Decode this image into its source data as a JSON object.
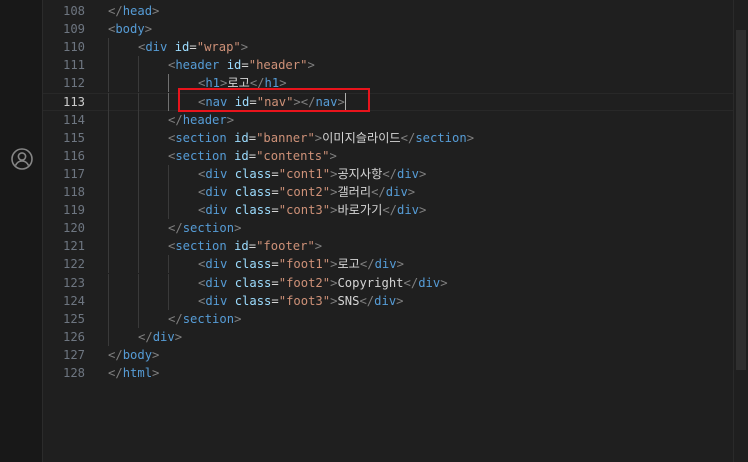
{
  "colors": {
    "background": "#1e1e1e",
    "tag": "#569cd6",
    "attribute": "#9cdcfe",
    "string": "#ce9178",
    "text": "#d4d4d4",
    "punctuation": "#808080",
    "line_number": "#6e7681",
    "highlight_box": "#e8141c"
  },
  "activity_bar": {
    "icons": [
      "account-icon"
    ]
  },
  "editor": {
    "current_line": "113",
    "lines": [
      {
        "num": "108",
        "tokens": [
          {
            "c": "t-punct",
            "v": "</"
          },
          {
            "c": "t-tag",
            "v": "head"
          },
          {
            "c": "t-punct",
            "v": ">"
          }
        ]
      },
      {
        "num": "109",
        "tokens": [
          {
            "c": "t-punct",
            "v": "<"
          },
          {
            "c": "t-tag",
            "v": "body"
          },
          {
            "c": "t-punct",
            "v": ">"
          }
        ]
      },
      {
        "num": "110",
        "tokens": [
          {
            "c": "t-punct",
            "v": "<"
          },
          {
            "c": "t-tag",
            "v": "div"
          },
          {
            "c": "t-eq",
            "v": " "
          },
          {
            "c": "t-attr",
            "v": "id"
          },
          {
            "c": "t-eq",
            "v": "="
          },
          {
            "c": "t-str",
            "v": "\"wrap\""
          },
          {
            "c": "t-punct",
            "v": ">"
          }
        ]
      },
      {
        "num": "111",
        "tokens": [
          {
            "c": "t-punct",
            "v": "<"
          },
          {
            "c": "t-tag",
            "v": "header"
          },
          {
            "c": "t-eq",
            "v": " "
          },
          {
            "c": "t-attr",
            "v": "id"
          },
          {
            "c": "t-eq",
            "v": "="
          },
          {
            "c": "t-str",
            "v": "\"header\""
          },
          {
            "c": "t-punct",
            "v": ">"
          }
        ]
      },
      {
        "num": "112",
        "tokens": [
          {
            "c": "t-punct",
            "v": "<"
          },
          {
            "c": "t-tag",
            "v": "h1"
          },
          {
            "c": "t-punct",
            "v": ">"
          },
          {
            "c": "t-text",
            "v": "로고"
          },
          {
            "c": "t-punct",
            "v": "</"
          },
          {
            "c": "t-tag",
            "v": "h1"
          },
          {
            "c": "t-punct",
            "v": ">"
          }
        ]
      },
      {
        "num": "113",
        "tokens": [
          {
            "c": "t-punct",
            "v": "<"
          },
          {
            "c": "t-tag",
            "v": "nav"
          },
          {
            "c": "t-eq",
            "v": " "
          },
          {
            "c": "t-attr",
            "v": "id"
          },
          {
            "c": "t-eq",
            "v": "="
          },
          {
            "c": "t-str",
            "v": "\"nav\""
          },
          {
            "c": "t-punct",
            "v": "></"
          },
          {
            "c": "t-tag",
            "v": "nav"
          },
          {
            "c": "t-punct",
            "v": ">"
          }
        ]
      },
      {
        "num": "114",
        "tokens": [
          {
            "c": "t-punct",
            "v": "</"
          },
          {
            "c": "t-tag",
            "v": "header"
          },
          {
            "c": "t-punct",
            "v": ">"
          }
        ]
      },
      {
        "num": "115",
        "tokens": [
          {
            "c": "t-punct",
            "v": "<"
          },
          {
            "c": "t-tag",
            "v": "section"
          },
          {
            "c": "t-eq",
            "v": " "
          },
          {
            "c": "t-attr",
            "v": "id"
          },
          {
            "c": "t-eq",
            "v": "="
          },
          {
            "c": "t-str",
            "v": "\"banner\""
          },
          {
            "c": "t-punct",
            "v": ">"
          },
          {
            "c": "t-text",
            "v": "이미지슬라이드"
          },
          {
            "c": "t-punct",
            "v": "</"
          },
          {
            "c": "t-tag",
            "v": "section"
          },
          {
            "c": "t-punct",
            "v": ">"
          }
        ]
      },
      {
        "num": "116",
        "tokens": [
          {
            "c": "t-punct",
            "v": "<"
          },
          {
            "c": "t-tag",
            "v": "section"
          },
          {
            "c": "t-eq",
            "v": " "
          },
          {
            "c": "t-attr",
            "v": "id"
          },
          {
            "c": "t-eq",
            "v": "="
          },
          {
            "c": "t-str",
            "v": "\"contents\""
          },
          {
            "c": "t-punct",
            "v": ">"
          }
        ]
      },
      {
        "num": "117",
        "tokens": [
          {
            "c": "t-punct",
            "v": "<"
          },
          {
            "c": "t-tag",
            "v": "div"
          },
          {
            "c": "t-eq",
            "v": " "
          },
          {
            "c": "t-attr",
            "v": "class"
          },
          {
            "c": "t-eq",
            "v": "="
          },
          {
            "c": "t-str",
            "v": "\"cont1\""
          },
          {
            "c": "t-punct",
            "v": ">"
          },
          {
            "c": "t-text",
            "v": "공지사항"
          },
          {
            "c": "t-punct",
            "v": "</"
          },
          {
            "c": "t-tag",
            "v": "div"
          },
          {
            "c": "t-punct",
            "v": ">"
          }
        ]
      },
      {
        "num": "118",
        "tokens": [
          {
            "c": "t-punct",
            "v": "<"
          },
          {
            "c": "t-tag",
            "v": "div"
          },
          {
            "c": "t-eq",
            "v": " "
          },
          {
            "c": "t-attr",
            "v": "class"
          },
          {
            "c": "t-eq",
            "v": "="
          },
          {
            "c": "t-str",
            "v": "\"cont2\""
          },
          {
            "c": "t-punct",
            "v": ">"
          },
          {
            "c": "t-text",
            "v": "갤러리"
          },
          {
            "c": "t-punct",
            "v": "</"
          },
          {
            "c": "t-tag",
            "v": "div"
          },
          {
            "c": "t-punct",
            "v": ">"
          }
        ]
      },
      {
        "num": "119",
        "tokens": [
          {
            "c": "t-punct",
            "v": "<"
          },
          {
            "c": "t-tag",
            "v": "div"
          },
          {
            "c": "t-eq",
            "v": " "
          },
          {
            "c": "t-attr",
            "v": "class"
          },
          {
            "c": "t-eq",
            "v": "="
          },
          {
            "c": "t-str",
            "v": "\"cont3\""
          },
          {
            "c": "t-punct",
            "v": ">"
          },
          {
            "c": "t-text",
            "v": "바로가기"
          },
          {
            "c": "t-punct",
            "v": "</"
          },
          {
            "c": "t-tag",
            "v": "div"
          },
          {
            "c": "t-punct",
            "v": ">"
          }
        ]
      },
      {
        "num": "120",
        "tokens": [
          {
            "c": "t-punct",
            "v": "</"
          },
          {
            "c": "t-tag",
            "v": "section"
          },
          {
            "c": "t-punct",
            "v": ">"
          }
        ]
      },
      {
        "num": "121",
        "tokens": [
          {
            "c": "t-punct",
            "v": "<"
          },
          {
            "c": "t-tag",
            "v": "section"
          },
          {
            "c": "t-eq",
            "v": " "
          },
          {
            "c": "t-attr",
            "v": "id"
          },
          {
            "c": "t-eq",
            "v": "="
          },
          {
            "c": "t-str",
            "v": "\"footer\""
          },
          {
            "c": "t-punct",
            "v": ">"
          }
        ]
      },
      {
        "num": "122",
        "tokens": [
          {
            "c": "t-punct",
            "v": "<"
          },
          {
            "c": "t-tag",
            "v": "div"
          },
          {
            "c": "t-eq",
            "v": " "
          },
          {
            "c": "t-attr",
            "v": "class"
          },
          {
            "c": "t-eq",
            "v": "="
          },
          {
            "c": "t-str",
            "v": "\"foot1\""
          },
          {
            "c": "t-punct",
            "v": ">"
          },
          {
            "c": "t-text",
            "v": "로고"
          },
          {
            "c": "t-punct",
            "v": "</"
          },
          {
            "c": "t-tag",
            "v": "div"
          },
          {
            "c": "t-punct",
            "v": ">"
          }
        ]
      },
      {
        "num": "123",
        "tokens": [
          {
            "c": "t-punct",
            "v": "<"
          },
          {
            "c": "t-tag",
            "v": "div"
          },
          {
            "c": "t-eq",
            "v": " "
          },
          {
            "c": "t-attr",
            "v": "class"
          },
          {
            "c": "t-eq",
            "v": "="
          },
          {
            "c": "t-str",
            "v": "\"foot2\""
          },
          {
            "c": "t-punct",
            "v": ">"
          },
          {
            "c": "t-text",
            "v": "Copyright"
          },
          {
            "c": "t-punct",
            "v": "</"
          },
          {
            "c": "t-tag",
            "v": "div"
          },
          {
            "c": "t-punct",
            "v": ">"
          }
        ]
      },
      {
        "num": "124",
        "tokens": [
          {
            "c": "t-punct",
            "v": "<"
          },
          {
            "c": "t-tag",
            "v": "div"
          },
          {
            "c": "t-eq",
            "v": " "
          },
          {
            "c": "t-attr",
            "v": "class"
          },
          {
            "c": "t-eq",
            "v": "="
          },
          {
            "c": "t-str",
            "v": "\"foot3\""
          },
          {
            "c": "t-punct",
            "v": ">"
          },
          {
            "c": "t-text",
            "v": "SNS"
          },
          {
            "c": "t-punct",
            "v": "</"
          },
          {
            "c": "t-tag",
            "v": "div"
          },
          {
            "c": "t-punct",
            "v": ">"
          }
        ]
      },
      {
        "num": "125",
        "tokens": [
          {
            "c": "t-punct",
            "v": "</"
          },
          {
            "c": "t-tag",
            "v": "section"
          },
          {
            "c": "t-punct",
            "v": ">"
          }
        ]
      },
      {
        "num": "126",
        "tokens": [
          {
            "c": "t-punct",
            "v": "</"
          },
          {
            "c": "t-tag",
            "v": "div"
          },
          {
            "c": "t-punct",
            "v": ">"
          }
        ]
      },
      {
        "num": "127",
        "tokens": [
          {
            "c": "t-punct",
            "v": "</"
          },
          {
            "c": "t-tag",
            "v": "body"
          },
          {
            "c": "t-punct",
            "v": ">"
          }
        ]
      },
      {
        "num": "128",
        "tokens": [
          {
            "c": "t-punct",
            "v": "</"
          },
          {
            "c": "t-tag",
            "v": "html"
          },
          {
            "c": "t-punct",
            "v": ">"
          }
        ]
      }
    ]
  }
}
